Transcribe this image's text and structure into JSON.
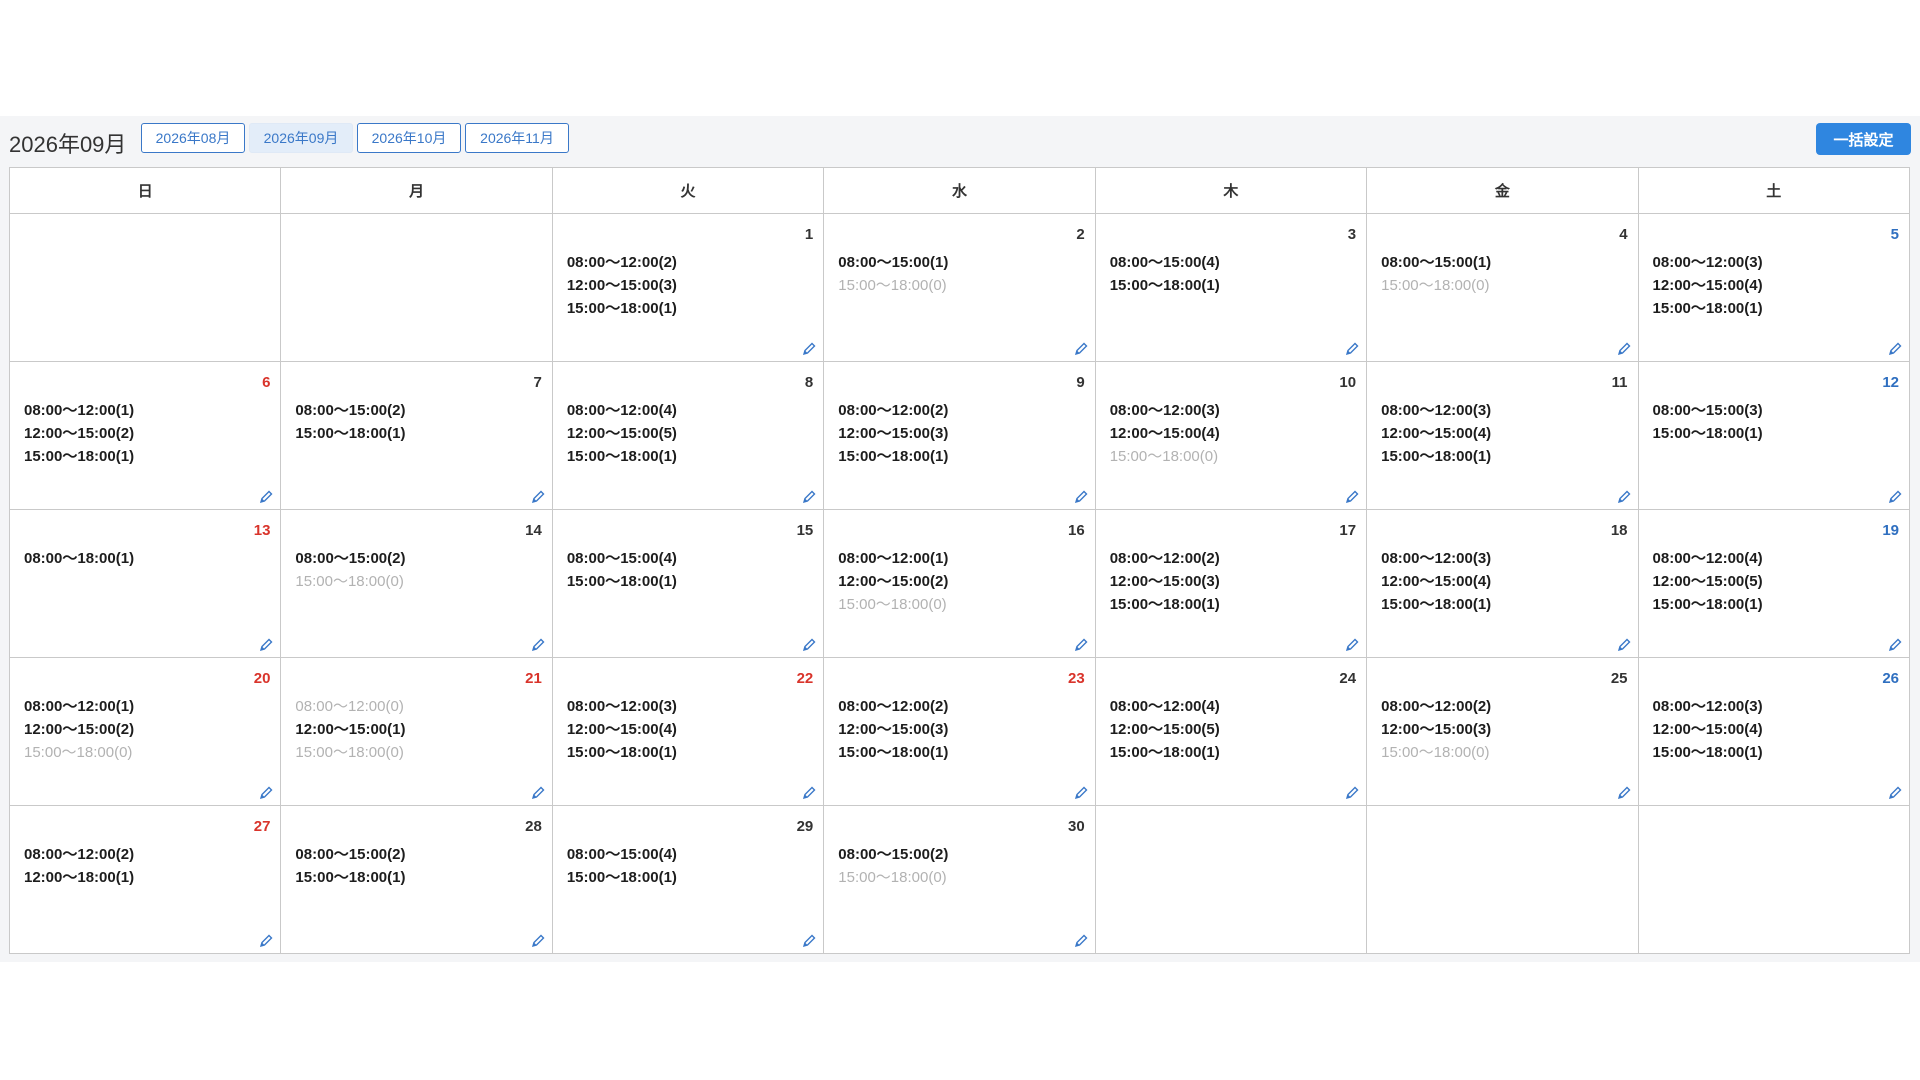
{
  "header": {
    "title": "2026年09月",
    "month_buttons": [
      "2026年08月",
      "2026年09月",
      "2026年10月",
      "2026年11月"
    ],
    "active_month_index": 1,
    "bulk_button": "一括設定"
  },
  "weekdays": [
    "日",
    "月",
    "火",
    "水",
    "木",
    "金",
    "土"
  ],
  "colors": {
    "available_cell": "#fefaa9",
    "sunday_holiday": "#d9342b",
    "saturday": "#2f6fc0",
    "primary": "#2f86e0"
  },
  "weeks": [
    [
      null,
      null,
      {
        "day": "1",
        "color": "default",
        "slots": [
          {
            "t": "08:00〜12:00(2)"
          },
          {
            "t": "12:00〜15:00(3)"
          },
          {
            "t": "15:00〜18:00(1)"
          }
        ]
      },
      {
        "day": "2",
        "color": "default",
        "slots": [
          {
            "t": "08:00〜15:00(1)"
          },
          {
            "t": "15:00〜18:00(0)",
            "dim": true
          }
        ]
      },
      {
        "day": "3",
        "color": "default",
        "slots": [
          {
            "t": "08:00〜15:00(4)"
          },
          {
            "t": "15:00〜18:00(1)"
          }
        ]
      },
      {
        "day": "4",
        "color": "default",
        "slots": [
          {
            "t": "08:00〜15:00(1)"
          },
          {
            "t": "15:00〜18:00(0)",
            "dim": true
          }
        ]
      },
      {
        "day": "5",
        "color": "blue",
        "slots": [
          {
            "t": "08:00〜12:00(3)"
          },
          {
            "t": "12:00〜15:00(4)"
          },
          {
            "t": "15:00〜18:00(1)"
          }
        ]
      }
    ],
    [
      {
        "day": "6",
        "color": "red",
        "slots": [
          {
            "t": "08:00〜12:00(1)"
          },
          {
            "t": "12:00〜15:00(2)"
          },
          {
            "t": "15:00〜18:00(1)"
          }
        ]
      },
      {
        "day": "7",
        "color": "default",
        "slots": [
          {
            "t": "08:00〜15:00(2)"
          },
          {
            "t": "15:00〜18:00(1)"
          }
        ]
      },
      {
        "day": "8",
        "color": "default",
        "slots": [
          {
            "t": "08:00〜12:00(4)"
          },
          {
            "t": "12:00〜15:00(5)"
          },
          {
            "t": "15:00〜18:00(1)"
          }
        ]
      },
      {
        "day": "9",
        "color": "default",
        "slots": [
          {
            "t": "08:00〜12:00(2)"
          },
          {
            "t": "12:00〜15:00(3)"
          },
          {
            "t": "15:00〜18:00(1)"
          }
        ]
      },
      {
        "day": "10",
        "color": "default",
        "slots": [
          {
            "t": "08:00〜12:00(3)"
          },
          {
            "t": "12:00〜15:00(4)"
          },
          {
            "t": "15:00〜18:00(0)",
            "dim": true
          }
        ]
      },
      {
        "day": "11",
        "color": "default",
        "slots": [
          {
            "t": "08:00〜12:00(3)"
          },
          {
            "t": "12:00〜15:00(4)"
          },
          {
            "t": "15:00〜18:00(1)"
          }
        ]
      },
      {
        "day": "12",
        "color": "blue",
        "slots": [
          {
            "t": "08:00〜15:00(3)"
          },
          {
            "t": "15:00〜18:00(1)"
          }
        ]
      }
    ],
    [
      {
        "day": "13",
        "color": "red",
        "slots": [
          {
            "t": "08:00〜18:00(1)"
          }
        ]
      },
      {
        "day": "14",
        "color": "default",
        "slots": [
          {
            "t": "08:00〜15:00(2)"
          },
          {
            "t": "15:00〜18:00(0)",
            "dim": true
          }
        ]
      },
      {
        "day": "15",
        "color": "default",
        "slots": [
          {
            "t": "08:00〜15:00(4)"
          },
          {
            "t": "15:00〜18:00(1)"
          }
        ]
      },
      {
        "day": "16",
        "color": "default",
        "slots": [
          {
            "t": "08:00〜12:00(1)"
          },
          {
            "t": "12:00〜15:00(2)"
          },
          {
            "t": "15:00〜18:00(0)",
            "dim": true
          }
        ]
      },
      {
        "day": "17",
        "color": "default",
        "slots": [
          {
            "t": "08:00〜12:00(2)"
          },
          {
            "t": "12:00〜15:00(3)"
          },
          {
            "t": "15:00〜18:00(1)"
          }
        ]
      },
      {
        "day": "18",
        "color": "default",
        "slots": [
          {
            "t": "08:00〜12:00(3)"
          },
          {
            "t": "12:00〜15:00(4)"
          },
          {
            "t": "15:00〜18:00(1)"
          }
        ]
      },
      {
        "day": "19",
        "color": "blue",
        "slots": [
          {
            "t": "08:00〜12:00(4)"
          },
          {
            "t": "12:00〜15:00(5)"
          },
          {
            "t": "15:00〜18:00(1)"
          }
        ]
      }
    ],
    [
      {
        "day": "20",
        "color": "red",
        "slots": [
          {
            "t": "08:00〜12:00(1)"
          },
          {
            "t": "12:00〜15:00(2)"
          },
          {
            "t": "15:00〜18:00(0)",
            "dim": true
          }
        ]
      },
      {
        "day": "21",
        "color": "red",
        "slots": [
          {
            "t": "08:00〜12:00(0)",
            "dim": true
          },
          {
            "t": "12:00〜15:00(1)"
          },
          {
            "t": "15:00〜18:00(0)",
            "dim": true
          }
        ]
      },
      {
        "day": "22",
        "color": "red",
        "slots": [
          {
            "t": "08:00〜12:00(3)"
          },
          {
            "t": "12:00〜15:00(4)"
          },
          {
            "t": "15:00〜18:00(1)"
          }
        ]
      },
      {
        "day": "23",
        "color": "red",
        "slots": [
          {
            "t": "08:00〜12:00(2)"
          },
          {
            "t": "12:00〜15:00(3)"
          },
          {
            "t": "15:00〜18:00(1)"
          }
        ]
      },
      {
        "day": "24",
        "color": "default",
        "slots": [
          {
            "t": "08:00〜12:00(4)"
          },
          {
            "t": "12:00〜15:00(5)"
          },
          {
            "t": "15:00〜18:00(1)"
          }
        ]
      },
      {
        "day": "25",
        "color": "default",
        "slots": [
          {
            "t": "08:00〜12:00(2)"
          },
          {
            "t": "12:00〜15:00(3)"
          },
          {
            "t": "15:00〜18:00(0)",
            "dim": true
          }
        ]
      },
      {
        "day": "26",
        "color": "blue",
        "slots": [
          {
            "t": "08:00〜12:00(3)"
          },
          {
            "t": "12:00〜15:00(4)"
          },
          {
            "t": "15:00〜18:00(1)"
          }
        ]
      }
    ],
    [
      {
        "day": "27",
        "color": "red",
        "slots": [
          {
            "t": "08:00〜12:00(2)"
          },
          {
            "t": "12:00〜18:00(1)"
          }
        ]
      },
      {
        "day": "28",
        "color": "default",
        "slots": [
          {
            "t": "08:00〜15:00(2)"
          },
          {
            "t": "15:00〜18:00(1)"
          }
        ]
      },
      {
        "day": "29",
        "color": "default",
        "slots": [
          {
            "t": "08:00〜15:00(4)"
          },
          {
            "t": "15:00〜18:00(1)"
          }
        ]
      },
      {
        "day": "30",
        "color": "default",
        "slots": [
          {
            "t": "08:00〜15:00(2)"
          },
          {
            "t": "15:00〜18:00(0)",
            "dim": true
          }
        ]
      },
      null,
      null,
      null
    ]
  ]
}
